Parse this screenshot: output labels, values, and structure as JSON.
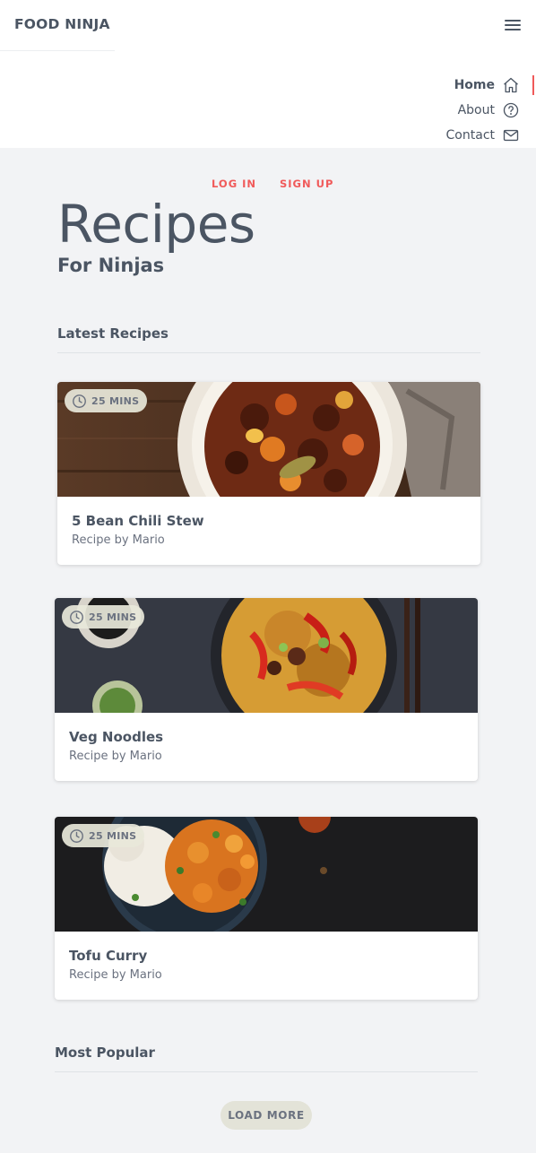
{
  "brand": {
    "name": "FOOD NINJA"
  },
  "menu_icon": "hamburger-menu-icon",
  "nav": {
    "items": [
      {
        "label": "Home",
        "icon": "home-icon",
        "active": true
      },
      {
        "label": "About",
        "icon": "help-circle-icon",
        "active": false
      },
      {
        "label": "Contact",
        "icon": "mail-icon",
        "active": false
      }
    ]
  },
  "auth": {
    "login": "LOG IN",
    "signup": "SIGN UP"
  },
  "hero": {
    "title": "Recipes",
    "subtitle": "For Ninjas"
  },
  "latest": {
    "heading": "Latest Recipes",
    "cards": [
      {
        "time": "25 MINS",
        "title": "5 Bean Chili Stew",
        "author": "Recipe by Mario"
      },
      {
        "time": "25 MINS",
        "title": "Veg Noodles",
        "author": "Recipe by Mario"
      },
      {
        "time": "25 MINS",
        "title": "Tofu Curry",
        "author": "Recipe by Mario"
      }
    ]
  },
  "popular": {
    "heading": "Most Popular"
  },
  "load_more": "LOAD MORE",
  "colors": {
    "accent": "#f05a5a",
    "text": "#4b5563",
    "background": "#f2f3f5",
    "badge": "#e8e8da"
  }
}
